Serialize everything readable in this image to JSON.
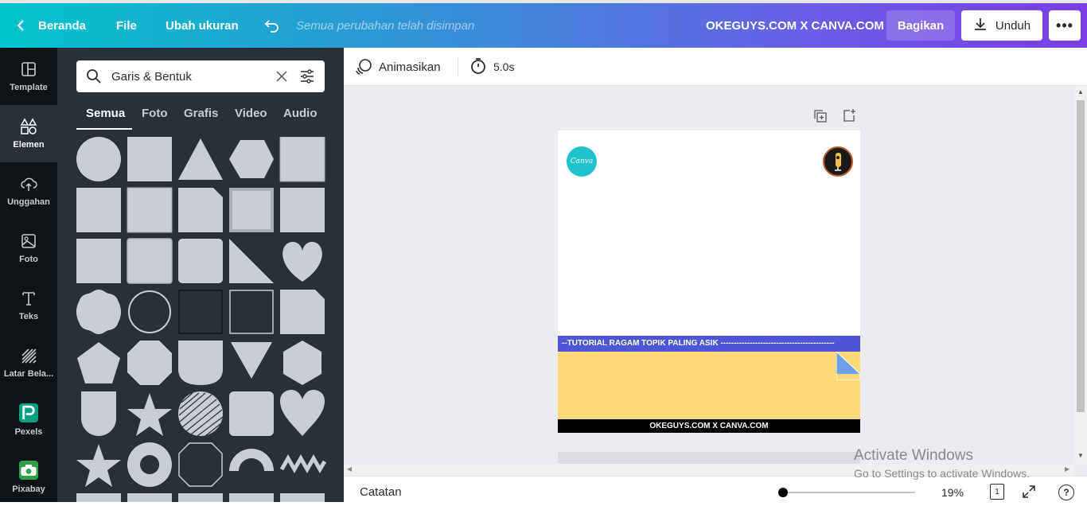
{
  "topbar": {
    "back_label": "Beranda",
    "file_label": "File",
    "resize_label": "Ubah ukuran",
    "saved_status": "Semua perubahan telah disimpan",
    "design_title": "OKEGUYS.COM X CANVA.COM",
    "share_label": "Bagikan",
    "download_label": "Unduh"
  },
  "rail": {
    "items": [
      {
        "label": "Template",
        "icon": "template-icon"
      },
      {
        "label": "Elemen",
        "icon": "shapes-icon"
      },
      {
        "label": "Unggahan",
        "icon": "cloud-upload-icon"
      },
      {
        "label": "Foto",
        "icon": "photo-icon"
      },
      {
        "label": "Teks",
        "icon": "text-icon"
      },
      {
        "label": "Latar Bela...",
        "icon": "stripes-icon"
      },
      {
        "label": "Pexels",
        "icon": "pexels-icon"
      },
      {
        "label": "Pixabay",
        "icon": "pixabay-icon"
      }
    ]
  },
  "panel": {
    "search_value": "Garis & Bentuk",
    "tabs": [
      "Semua",
      "Foto",
      "Grafis",
      "Video",
      "Audio"
    ],
    "active_tab": "Semua"
  },
  "editor_toolbar": {
    "animate_label": "Animasikan",
    "duration_label": "5.0s"
  },
  "design": {
    "banner_text": "--TUTORIAL RAGAM TOPIK PALING ASIK -------------------------------------------",
    "footer_text": "OKEGUYS.COM X CANVA.COM",
    "logo_text": "Canva",
    "colors": {
      "banner": "#4f55d4",
      "panel": "#fdd97a",
      "footer": "#000000",
      "logo": "#1ec3cb"
    }
  },
  "footer": {
    "notes_label": "Catatan",
    "zoom_label": "19%",
    "page_count": "1",
    "help_label": "?"
  },
  "watermark": {
    "line1": "Activate Windows",
    "line2": "Go to Settings to activate Windows."
  }
}
